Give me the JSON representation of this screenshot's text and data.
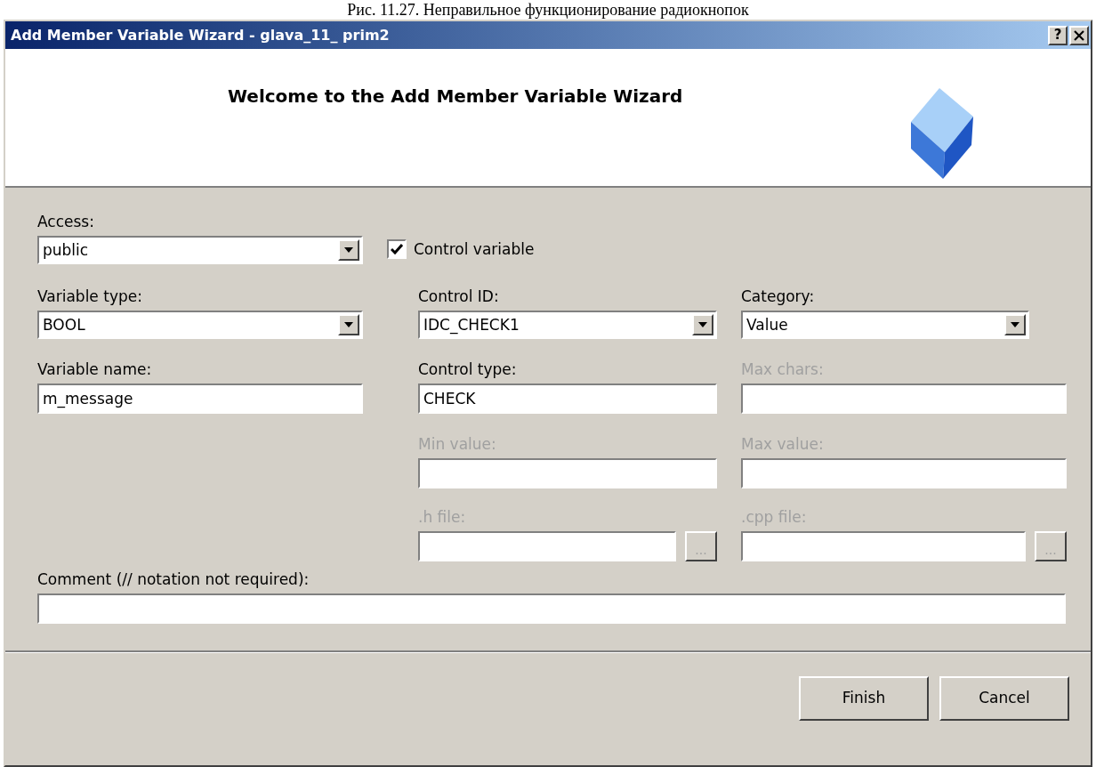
{
  "caption": "Рис. 11.27. Неправильное функционирование радиокнопок",
  "window": {
    "title": "Add Member Variable Wizard - glava_11_ prim2",
    "help": "?"
  },
  "header": {
    "title": "Welcome to the Add Member Variable Wizard"
  },
  "control_variable": {
    "label": "Control variable",
    "checked": true
  },
  "fields": {
    "access": {
      "kind": "combo",
      "label": "Access:",
      "value": "public",
      "disabled": false
    },
    "variable_type": {
      "kind": "combo",
      "label": "Variable type:",
      "value": "BOOL",
      "disabled": false
    },
    "variable_name": {
      "kind": "text",
      "label": "Variable name:",
      "value": "m_message",
      "disabled": false
    },
    "control_id": {
      "kind": "combo",
      "label": "Control ID:",
      "value": "IDC_CHECK1",
      "disabled": false
    },
    "category": {
      "kind": "combo",
      "label": "Category:",
      "value": "Value",
      "disabled": false
    },
    "control_type": {
      "kind": "text",
      "label": "Control type:",
      "value": "CHECK",
      "disabled": false
    },
    "max_chars": {
      "kind": "text",
      "label": "Max chars:",
      "disabled": true
    },
    "min_value": {
      "kind": "text",
      "label": "Min value:",
      "disabled": true
    },
    "max_value": {
      "kind": "text",
      "label": "Max value:",
      "disabled": true
    },
    "h_file": {
      "kind": "browse",
      "label": ".h file:",
      "browse": "...",
      "disabled": true
    },
    "cpp_file": {
      "kind": "browse",
      "label": ".cpp file:",
      "browse": "...",
      "disabled": true
    },
    "comment": {
      "kind": "text",
      "label": "Comment (// notation not required):",
      "disabled": false
    }
  },
  "buttons": [
    {
      "label": "Finish"
    },
    {
      "label": "Cancel"
    }
  ]
}
